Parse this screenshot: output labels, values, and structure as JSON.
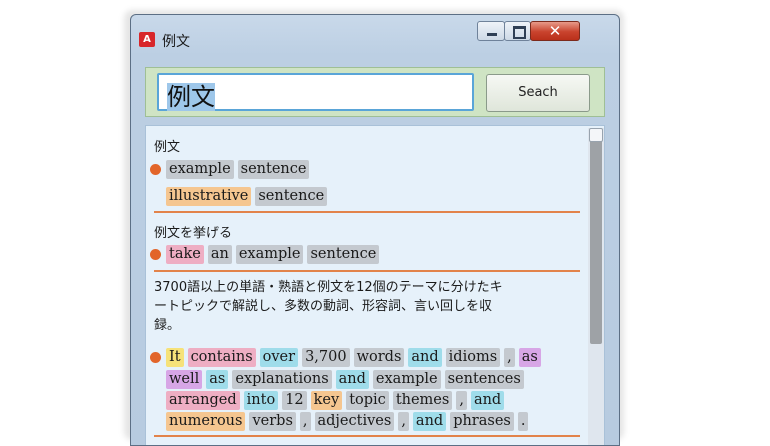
{
  "window": {
    "title": "例文",
    "app_icon": "dictionary-app-icon",
    "icons": {
      "minimize": "minimize-icon",
      "maximize": "maximize-icon",
      "close": "close-icon"
    },
    "close_glyph": "✕"
  },
  "search": {
    "value": "例文",
    "button_label": "Seach"
  },
  "entries": [
    {
      "heading": "例文",
      "lines": [
        [
          {
            "t": "example",
            "c": "g"
          },
          {
            "t": "sentence",
            "c": "g"
          }
        ],
        [
          {
            "t": "illustrative",
            "c": "o"
          },
          {
            "t": "sentence",
            "c": "g"
          }
        ]
      ]
    },
    {
      "heading": "例文を挙げる",
      "lines": [
        [
          {
            "t": "take",
            "c": "p"
          },
          {
            "t": "an",
            "c": "g"
          },
          {
            "t": "example",
            "c": "g"
          },
          {
            "t": "sentence",
            "c": "g"
          }
        ]
      ]
    },
    {
      "description": "3700語以上の単語・熟語と例文を12個のテーマに分けたキートピックで解説し、多数の動詞、形容詞、言い回しを収録。",
      "desc_lines": [
        "3700語以上の単語・熟語と例文を12個のテーマに分けたキ",
        "ートピックで解説し、多数の動詞、形容詞、言い回しを収",
        "録。"
      ],
      "lines": [
        [
          {
            "t": "It",
            "c": "y"
          },
          {
            "t": "contains",
            "c": "p"
          },
          {
            "t": "over",
            "c": "c"
          },
          {
            "t": "3,700",
            "c": "g"
          },
          {
            "t": "words",
            "c": "g"
          },
          {
            "t": "and",
            "c": "c"
          },
          {
            "t": "idioms",
            "c": "g"
          },
          {
            "t": ",",
            "c": "g"
          },
          {
            "t": "as",
            "c": "v"
          }
        ],
        [
          {
            "t": "well",
            "c": "v"
          },
          {
            "t": "as",
            "c": "c"
          },
          {
            "t": "explanations",
            "c": "g"
          },
          {
            "t": "and",
            "c": "c"
          },
          {
            "t": "example",
            "c": "g"
          },
          {
            "t": "sentences",
            "c": "g"
          }
        ],
        [
          {
            "t": "arranged",
            "c": "p"
          },
          {
            "t": "into",
            "c": "c"
          },
          {
            "t": "12",
            "c": "g"
          },
          {
            "t": "key",
            "c": "o"
          },
          {
            "t": "topic",
            "c": "g"
          },
          {
            "t": "themes",
            "c": "g"
          },
          {
            "t": ",",
            "c": "g"
          },
          {
            "t": "and",
            "c": "c"
          }
        ],
        [
          {
            "t": "numerous",
            "c": "o"
          },
          {
            "t": "verbs",
            "c": "g"
          },
          {
            "t": ",",
            "c": "g"
          },
          {
            "t": "adjectives",
            "c": "g"
          },
          {
            "t": ",",
            "c": "g"
          },
          {
            "t": "and",
            "c": "c"
          },
          {
            "t": "phrases",
            "c": "g"
          },
          {
            "t": ".",
            "c": "g"
          }
        ]
      ]
    }
  ],
  "colors": {
    "bullet": "#e2652a",
    "separator": "#e2834a",
    "tag_gray": "#c4c9cf",
    "tag_orange": "#f5c690",
    "tag_pink": "#eeaec3",
    "tag_cyan": "#9fdcea",
    "tag_violet": "#d7a6e6",
    "tag_yellow": "#f6e279"
  }
}
